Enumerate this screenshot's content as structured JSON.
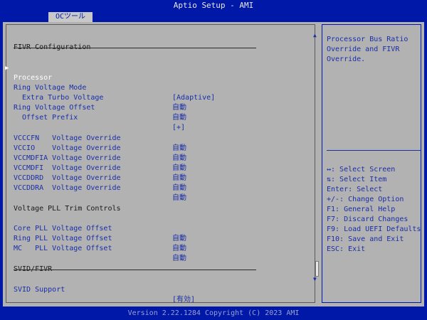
{
  "app": {
    "title": "Aptio Setup - AMI",
    "tab": "OCツール"
  },
  "section_title": "FIVR Configuration",
  "submenu": {
    "label": "Processor"
  },
  "settings": [
    {
      "label": "Ring Voltage Mode",
      "value": "[Adaptive]"
    },
    {
      "label": "Extra Turbo Voltage",
      "value": "自動"
    },
    {
      "label": "Ring Voltage Offset",
      "value": "自動"
    },
    {
      "label": "Offset Prefix",
      "value": "[+]"
    },
    {
      "label": "VCCCFN   Voltage Override",
      "value": "自動"
    },
    {
      "label": "VCCIO    Voltage Override",
      "value": "自動"
    },
    {
      "label": "VCCMDFIA Voltage Override",
      "value": "自動"
    },
    {
      "label": "VCCMDFI  Voltage Override",
      "value": "自動"
    },
    {
      "label": "VCCDDRD  Voltage Override",
      "value": "自動"
    },
    {
      "label": "VCCDDRA  Voltage Override",
      "value": "自動"
    },
    {
      "label": "Core PLL Voltage Offset",
      "value": "自動"
    },
    {
      "label": "Ring PLL Voltage Offset",
      "value": "自動"
    },
    {
      "label": "MC   PLL Voltage Offset",
      "value": "自動"
    },
    {
      "label": "SVID Support",
      "value": "[有効]"
    }
  ],
  "group_titles": {
    "pll": "Voltage PLL Trim Controls",
    "svid": "SVID/FIVR"
  },
  "help": {
    "description": "Processor Bus Ratio Override and FIVR Override."
  },
  "keys": [
    "↔: Select Screen",
    "⇅: Select Item",
    "Enter: Select",
    "+/-: Change Option",
    "F1: General Help",
    "F7: Discard Changes",
    "F9: Load UEFI Defaults",
    "F10: Save and Exit",
    "ESC: Exit"
  ],
  "footer": "Version 2.22.1284 Copyright (C) 2023 AMI",
  "colors": {
    "background": "#0018a8",
    "panel": "#b2b2b2",
    "text_blue": "#1a2ea8",
    "highlight": "#ffffff"
  },
  "icons": {
    "submenu_arrow": "triangle-right-icon",
    "scroll_up": "arrow-up-icon",
    "scroll_down": "arrow-down-icon"
  }
}
